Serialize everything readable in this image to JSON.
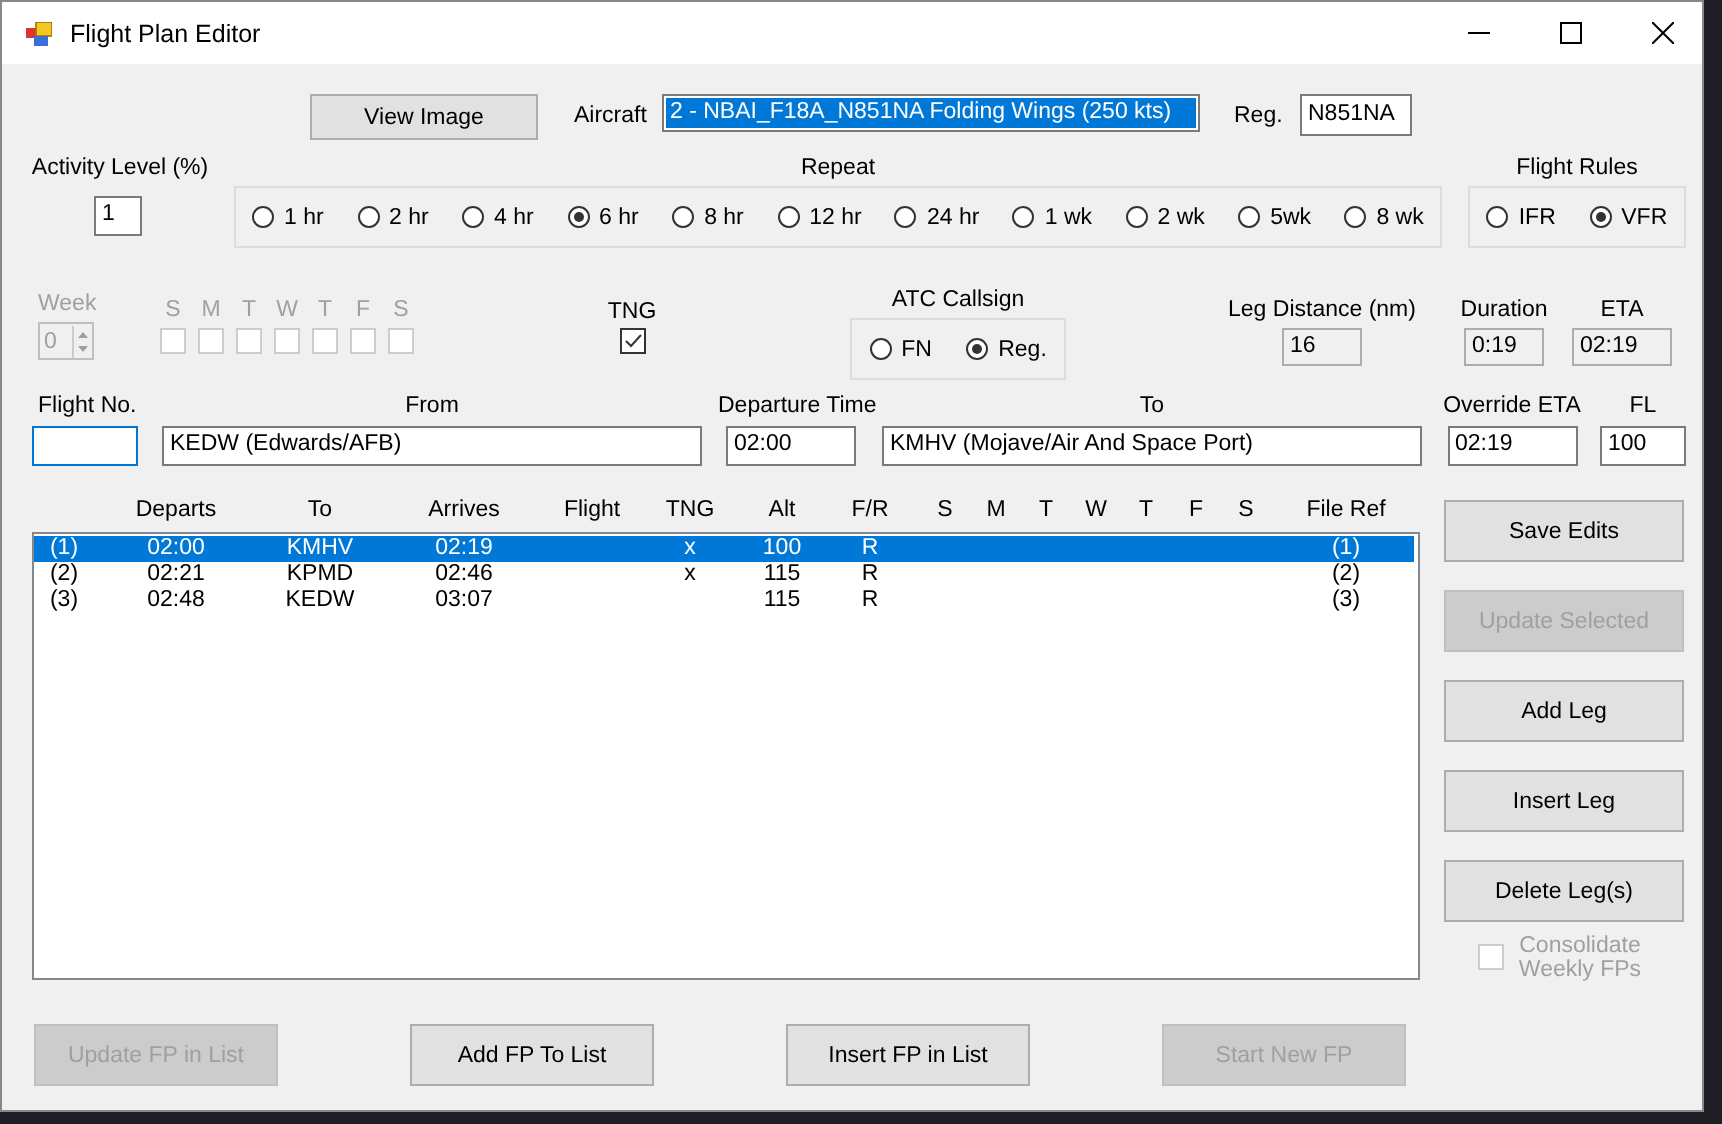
{
  "window": {
    "title": "Flight Plan Editor"
  },
  "view_image_button": {
    "label": "View Image"
  },
  "aircraft": {
    "label": "Aircraft",
    "value": "2 - NBAI_F18A_N851NA Folding Wings (250 kts)"
  },
  "reg": {
    "label": "Reg.",
    "value": "N851NA"
  },
  "activity_level": {
    "label": "Activity Level (%)",
    "value": "1"
  },
  "repeat": {
    "label": "Repeat",
    "options": [
      {
        "label": "1 hr",
        "selected": false
      },
      {
        "label": "2 hr",
        "selected": false
      },
      {
        "label": "4 hr",
        "selected": false
      },
      {
        "label": "6 hr",
        "selected": true
      },
      {
        "label": "8 hr",
        "selected": false
      },
      {
        "label": "12 hr",
        "selected": false
      },
      {
        "label": "24 hr",
        "selected": false
      },
      {
        "label": "1 wk",
        "selected": false
      },
      {
        "label": "2 wk",
        "selected": false
      },
      {
        "label": "5wk",
        "selected": false
      },
      {
        "label": "8 wk",
        "selected": false
      }
    ]
  },
  "flight_rules": {
    "label": "Flight Rules",
    "options": [
      {
        "label": "IFR",
        "selected": false
      },
      {
        "label": "VFR",
        "selected": true
      }
    ]
  },
  "week": {
    "label": "Week",
    "value": "0",
    "disabled": true
  },
  "days": {
    "disabled": true,
    "items": [
      {
        "label": "S",
        "checked": false
      },
      {
        "label": "M",
        "checked": false
      },
      {
        "label": "T",
        "checked": false
      },
      {
        "label": "W",
        "checked": false
      },
      {
        "label": "T",
        "checked": false
      },
      {
        "label": "F",
        "checked": false
      },
      {
        "label": "S",
        "checked": false
      }
    ]
  },
  "tng": {
    "label": "TNG",
    "checked": true
  },
  "atc_callsign": {
    "label": "ATC Callsign",
    "options": [
      {
        "label": "FN",
        "selected": false
      },
      {
        "label": "Reg.",
        "selected": true
      }
    ]
  },
  "leg_distance": {
    "label": "Leg Distance (nm)",
    "value": "16"
  },
  "duration": {
    "label": "Duration",
    "value": "0:19"
  },
  "eta": {
    "label": "ETA",
    "value": "02:19"
  },
  "flight_no": {
    "label": "Flight No."
  },
  "from": {
    "label": "From",
    "value": "KEDW (Edwards/AFB)"
  },
  "departure_time": {
    "label": "Departure Time",
    "value": "02:00"
  },
  "to": {
    "label": "To",
    "value": "KMHV (Mojave/Air And Space Port)"
  },
  "override_eta": {
    "label": "Override ETA",
    "value": "02:19"
  },
  "fl": {
    "label": "FL",
    "value": "100"
  },
  "legs": {
    "columns": [
      "Departs",
      "To",
      "Arrives",
      "Flight",
      "TNG",
      "Alt",
      "F/R",
      "S",
      "M",
      "T",
      "W",
      "T",
      "F",
      "S",
      "File Ref"
    ],
    "rows": [
      {
        "num": "(1)",
        "departs": "02:00",
        "to": "KMHV",
        "arrives": "02:19",
        "tng": "x",
        "alt": "100",
        "fr": "R",
        "file_ref": "(1)",
        "selected": true
      },
      {
        "num": "(2)",
        "departs": "02:21",
        "to": "KPMD",
        "arrives": "02:46",
        "tng": "x",
        "alt": "115",
        "fr": "R",
        "file_ref": "(2)",
        "selected": false
      },
      {
        "num": "(3)",
        "departs": "02:48",
        "to": "KEDW",
        "arrives": "03:07",
        "alt": "115",
        "fr": "R",
        "file_ref": "(3)",
        "selected": false
      }
    ]
  },
  "side_buttons": [
    {
      "label": "Save Edits",
      "disabled": false
    },
    {
      "label": "Update Selected",
      "disabled": true
    },
    {
      "label": "Add Leg",
      "disabled": false
    },
    {
      "label": "Insert Leg",
      "disabled": false
    },
    {
      "label": "Delete Leg(s)",
      "disabled": false
    }
  ],
  "consolidate": {
    "label": "Consolidate Weekly FPs",
    "checked": false,
    "disabled": true
  },
  "bottom_buttons": [
    {
      "label": "Update FP in List",
      "disabled": true
    },
    {
      "label": "Add FP To List",
      "disabled": false
    },
    {
      "label": "Insert FP in List",
      "disabled": false
    },
    {
      "label": "Start New FP",
      "disabled": true
    }
  ]
}
